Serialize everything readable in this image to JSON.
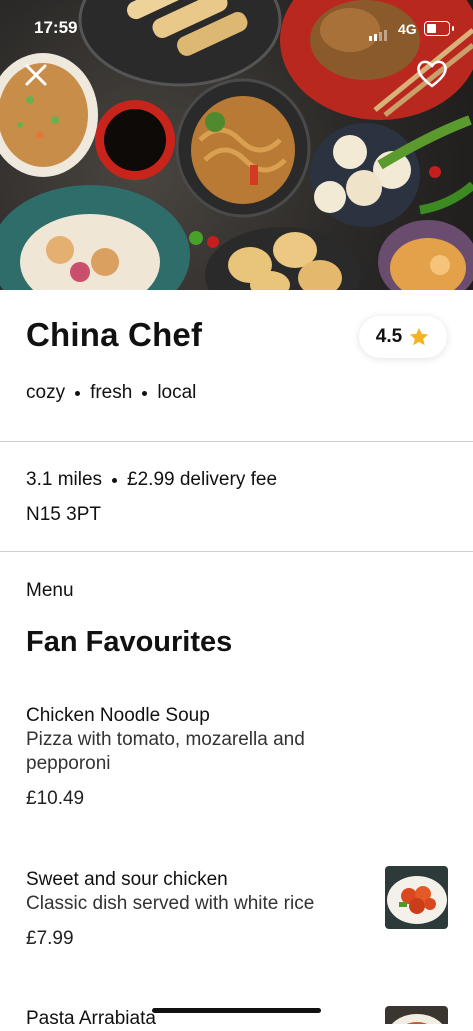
{
  "status_bar": {
    "time": "17:59",
    "network": "4G"
  },
  "hero": {
    "close_icon": "close-icon",
    "favorite_icon": "heart-outline-icon"
  },
  "restaurant": {
    "name": "China Chef",
    "rating": "4.5",
    "tags": [
      "cozy",
      "fresh",
      "local"
    ],
    "distance": "3.1 miles",
    "delivery_fee": "£2.99 delivery fee",
    "postcode": "N15 3PT"
  },
  "menu": {
    "label": "Menu",
    "section_title": "Fan Favourites",
    "items": [
      {
        "name": "Chicken Noodle Soup",
        "description": "Pizza with tomato, mozarella and pepporoni",
        "price": "£10.49"
      },
      {
        "name": "Sweet and sour chicken",
        "description": "Classic dish served with white rice",
        "price": "£7.99"
      },
      {
        "name": "Pasta Arrabiata"
      }
    ]
  },
  "colors": {
    "star": "#f5b323",
    "divider": "#cfcfcf",
    "text": "#111111"
  }
}
